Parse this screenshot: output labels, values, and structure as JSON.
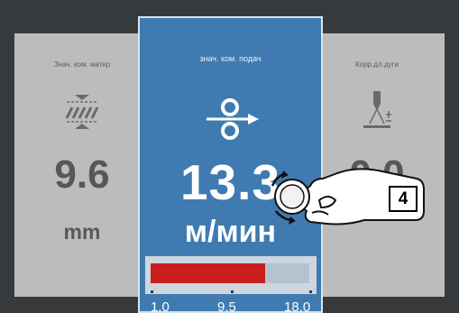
{
  "left_card": {
    "title": "Знач. ком. матер",
    "value": "9.6",
    "unit": "mm",
    "icon": "material-thickness-icon"
  },
  "center_card": {
    "title": "знач. ком. подач",
    "value": "13.3",
    "unit": "м/мин",
    "icon": "wire-feed-icon",
    "range": {
      "min_label": "1.0",
      "mid_label": "9.5",
      "max_label": "18.0",
      "fill_percent": 72,
      "fill_color": "#c81e1e"
    }
  },
  "right_card": {
    "title": "Корр.дл.дуги",
    "value": "0.0",
    "unit": "",
    "icon": "arc-length-icon"
  },
  "overlay": {
    "gesture": "hand-turning-knob-icon",
    "step_number": "4"
  },
  "colors": {
    "background": "#363a3c",
    "active_card": "#3f7bb0",
    "inactive_card": "#bcbcbc"
  }
}
